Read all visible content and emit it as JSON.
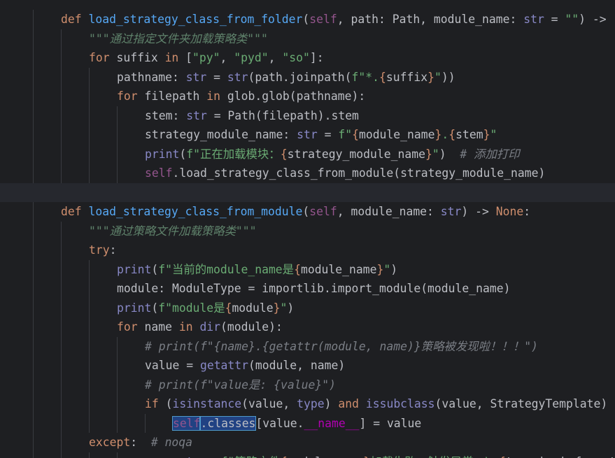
{
  "editor": {
    "lines": [
      {
        "indent": 1,
        "tokens": [
          [
            "kw",
            "def "
          ],
          [
            "fn",
            "load_strategy_class_from_folder"
          ],
          [
            "txt",
            "("
          ],
          [
            "slf",
            "self"
          ],
          [
            "txt",
            ", path: Path, module_name: "
          ],
          [
            "bi",
            "str"
          ],
          [
            "txt",
            " = "
          ],
          [
            "str",
            "\"\""
          ],
          [
            "txt",
            ") ->"
          ]
        ]
      },
      {
        "indent": 2,
        "tokens": [
          [
            "doc",
            "\"\"\"通过指定文件夹加载策略类\"\"\""
          ]
        ]
      },
      {
        "indent": 2,
        "tokens": [
          [
            "kw",
            "for "
          ],
          [
            "txt",
            "suffix "
          ],
          [
            "kw",
            "in "
          ],
          [
            "txt",
            "["
          ],
          [
            "str",
            "\"py\""
          ],
          [
            "txt",
            ", "
          ],
          [
            "str",
            "\"pyd\""
          ],
          [
            "txt",
            ", "
          ],
          [
            "str",
            "\"so\""
          ],
          [
            "txt",
            "]:"
          ]
        ]
      },
      {
        "indent": 3,
        "tokens": [
          [
            "txt",
            "pathname: "
          ],
          [
            "bi",
            "str"
          ],
          [
            "txt",
            " = "
          ],
          [
            "bi",
            "str"
          ],
          [
            "txt",
            "(path.joinpath("
          ],
          [
            "str",
            "f\"*."
          ],
          [
            "fmt",
            "{"
          ],
          [
            "txt",
            "suffix"
          ],
          [
            "fmt",
            "}"
          ],
          [
            "str",
            "\""
          ],
          [
            "txt",
            "))"
          ]
        ]
      },
      {
        "indent": 3,
        "tokens": [
          [
            "kw",
            "for "
          ],
          [
            "txt",
            "filepath "
          ],
          [
            "kw",
            "in "
          ],
          [
            "txt",
            "glob.glob(pathname):"
          ]
        ]
      },
      {
        "indent": 4,
        "tokens": [
          [
            "txt",
            "stem: "
          ],
          [
            "bi",
            "str"
          ],
          [
            "txt",
            " = Path(filepath).stem"
          ]
        ]
      },
      {
        "indent": 4,
        "tokens": [
          [
            "txt",
            "strategy_module_name: "
          ],
          [
            "bi",
            "str"
          ],
          [
            "txt",
            " = "
          ],
          [
            "str",
            "f\""
          ],
          [
            "fmt",
            "{"
          ],
          [
            "txt",
            "module_name"
          ],
          [
            "fmt",
            "}"
          ],
          [
            "str",
            "."
          ],
          [
            "fmt",
            "{"
          ],
          [
            "txt",
            "stem"
          ],
          [
            "fmt",
            "}"
          ],
          [
            "str",
            "\""
          ]
        ]
      },
      {
        "indent": 4,
        "tokens": [
          [
            "bi",
            "print"
          ],
          [
            "txt",
            "("
          ],
          [
            "str",
            "f\"正在加载模块："
          ],
          [
            "fmt",
            "{"
          ],
          [
            "txt",
            "strategy_module_name"
          ],
          [
            "fmt",
            "}"
          ],
          [
            "str",
            "\""
          ],
          [
            "txt",
            ")  "
          ],
          [
            "com",
            "# 添加打印"
          ]
        ]
      },
      {
        "indent": 4,
        "tokens": [
          [
            "slf",
            "self"
          ],
          [
            "txt",
            ".load_strategy_class_from_module(strategy_module_name)"
          ]
        ]
      },
      {
        "indent": 0,
        "current": true,
        "tokens": []
      },
      {
        "indent": 1,
        "tokens": [
          [
            "kw",
            "def "
          ],
          [
            "fn",
            "load_strategy_class_from_module"
          ],
          [
            "txt",
            "("
          ],
          [
            "slf",
            "self"
          ],
          [
            "txt",
            ", module_name: "
          ],
          [
            "bi",
            "str"
          ],
          [
            "txt",
            ") -> "
          ],
          [
            "kw",
            "None"
          ],
          [
            "txt",
            ":"
          ]
        ]
      },
      {
        "indent": 2,
        "tokens": [
          [
            "doc",
            "\"\"\"通过策略文件加载策略类\"\"\""
          ]
        ]
      },
      {
        "indent": 2,
        "tokens": [
          [
            "kw",
            "try"
          ],
          [
            "txt",
            ":"
          ]
        ]
      },
      {
        "indent": 3,
        "tokens": [
          [
            "bi",
            "print"
          ],
          [
            "txt",
            "("
          ],
          [
            "str",
            "f\"当前的module_name是"
          ],
          [
            "fmt",
            "{"
          ],
          [
            "txt",
            "module_name"
          ],
          [
            "fmt",
            "}"
          ],
          [
            "str",
            "\""
          ],
          [
            "txt",
            ")"
          ]
        ]
      },
      {
        "indent": 3,
        "tokens": [
          [
            "txt",
            "module: ModuleType = importlib.import_module(module_name)"
          ]
        ]
      },
      {
        "indent": 3,
        "tokens": [
          [
            "bi",
            "print"
          ],
          [
            "txt",
            "("
          ],
          [
            "str",
            "f\"module是"
          ],
          [
            "fmt",
            "{"
          ],
          [
            "txt",
            "module"
          ],
          [
            "fmt",
            "}"
          ],
          [
            "str",
            "\""
          ],
          [
            "txt",
            ")"
          ]
        ]
      },
      {
        "indent": 3,
        "tokens": [
          [
            "kw",
            "for "
          ],
          [
            "txt",
            "name "
          ],
          [
            "kw",
            "in "
          ],
          [
            "bi",
            "dir"
          ],
          [
            "txt",
            "(module):"
          ]
        ]
      },
      {
        "indent": 4,
        "tokens": [
          [
            "com",
            "# print(f\"{name}.{getattr(module, name)}策略被发现啦！！！\")"
          ]
        ]
      },
      {
        "indent": 4,
        "tokens": [
          [
            "txt",
            "value = "
          ],
          [
            "bi",
            "getattr"
          ],
          [
            "txt",
            "(module, name)"
          ]
        ]
      },
      {
        "indent": 4,
        "tokens": [
          [
            "com",
            "# print(f\"value是: {value}\")"
          ]
        ]
      },
      {
        "indent": 4,
        "tokens": [
          [
            "kw",
            "if "
          ],
          [
            "txt",
            "("
          ],
          [
            "bi",
            "isinstance"
          ],
          [
            "txt",
            "(value, "
          ],
          [
            "bi",
            "type"
          ],
          [
            "txt",
            ") "
          ],
          [
            "kw",
            "and "
          ],
          [
            "bi",
            "issubclass"
          ],
          [
            "txt",
            "(value, StrategyTemplate)"
          ]
        ]
      },
      {
        "indent": 5,
        "tokens": [
          [
            "slf hl",
            "self"
          ],
          [
            "txt hl",
            ".classes"
          ],
          [
            "txt",
            "[value."
          ],
          [
            "dun",
            "__name__"
          ],
          [
            "txt",
            "] = value"
          ]
        ]
      },
      {
        "indent": 2,
        "tokens": [
          [
            "kw",
            "except"
          ],
          [
            "txt",
            ":  "
          ],
          [
            "com",
            "# noqa"
          ]
        ]
      },
      {
        "indent": 4,
        "tokens": [
          [
            "txt",
            "msg: "
          ],
          [
            "bi",
            "str"
          ],
          [
            "txt",
            " = "
          ],
          [
            "str",
            "f\"策略文件"
          ],
          [
            "fmt",
            "{"
          ],
          [
            "txt",
            "module_name"
          ],
          [
            "fmt",
            "}"
          ],
          [
            "str",
            "加载失败，触发异常：\\n"
          ],
          [
            "fmt",
            "{"
          ],
          [
            "txt",
            "traceback.format_exc()"
          ],
          [
            "fmt",
            "}"
          ],
          [
            "str",
            "\""
          ]
        ]
      }
    ]
  }
}
